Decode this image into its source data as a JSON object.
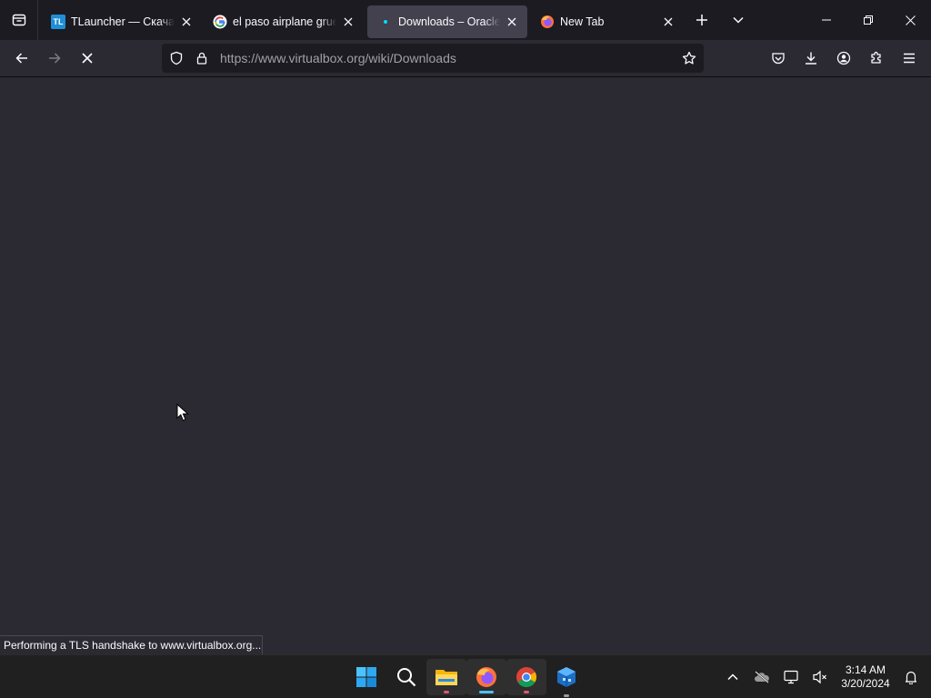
{
  "tabs": [
    {
      "title": "TLauncher — Скачать",
      "favicon": "tlauncher-favicon",
      "favicon_text": "TL",
      "active": false
    },
    {
      "title": "el paso airplane grueso",
      "favicon": "google-favicon",
      "active": false
    },
    {
      "title": "Downloads – Oracle VM VirtualBox",
      "favicon": "loading-dot-icon",
      "active": true
    },
    {
      "title": "New Tab",
      "favicon": "firefox-favicon",
      "active": false
    }
  ],
  "urlbar": {
    "url": "https://www.virtualbox.org/wiki/Downloads"
  },
  "status": {
    "text": "Performing a TLS handshake to www.virtualbox.org..."
  },
  "taskbar": {
    "apps": [
      {
        "name": "start-button",
        "running": false
      },
      {
        "name": "search-button",
        "running": false
      },
      {
        "name": "file-explorer",
        "running": true
      },
      {
        "name": "firefox",
        "running": true,
        "active": true
      },
      {
        "name": "chrome",
        "running": true
      },
      {
        "name": "virtualbox",
        "running": false
      }
    ],
    "clock": {
      "time": "3:14 AM",
      "date": "3/20/2024"
    }
  },
  "colors": {
    "tabstrip_bg": "#1c1b22",
    "toolbar_bg": "#2b2a33",
    "active_tab_bg": "#42414d",
    "urlbar_bg": "#1c1b22",
    "accent": "#4cc2ff",
    "taskbar_bg": "#202020"
  }
}
